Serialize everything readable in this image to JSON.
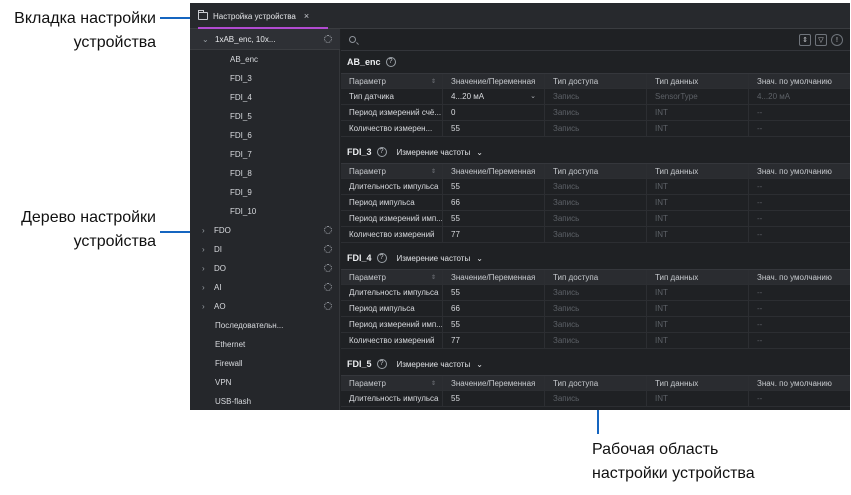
{
  "annotations": {
    "tab": [
      "Вкладка настройки",
      "устройства"
    ],
    "tree": [
      "Дерево настройки",
      "устройства"
    ],
    "workspace": [
      "Рабочая область",
      "настройки устройства"
    ]
  },
  "tab": {
    "title": "Настройка устройства",
    "icon": "folder-icon",
    "close": "×"
  },
  "sidebar": {
    "head": "1xAB_enc, 10x...",
    "children": [
      "AB_enc",
      "FDI_3",
      "FDI_4",
      "FDI_5",
      "FDI_6",
      "FDI_7",
      "FDI_8",
      "FDI_9",
      "FDI_10"
    ],
    "groups": [
      "FDO",
      "DI",
      "DO",
      "AI",
      "AO"
    ],
    "leaves": [
      "Последовательн...",
      "Ethernet",
      "Firewall",
      "VPN",
      "USB-flash"
    ]
  },
  "columns": [
    "Параметр",
    "Значение/Переменная",
    "Тип доступа",
    "Тип данных",
    "Знач. по умолчанию"
  ],
  "sections": [
    {
      "title": "AB_enc",
      "subtitle": "",
      "rows": [
        [
          "Тип датчика",
          "4...20 мА",
          "Запись",
          "SensorType",
          "4...20 мА"
        ],
        [
          "Период измерений счё...",
          "0",
          "Запись",
          "INT",
          "--"
        ],
        [
          "Количество измерен...",
          "55",
          "Запись",
          "INT",
          "--"
        ]
      ]
    },
    {
      "title": "FDI_3",
      "subtitle": "Измерение частоты",
      "rows": [
        [
          "Длительность импульса",
          "55",
          "Запись",
          "INT",
          "--"
        ],
        [
          "Период импульса",
          "66",
          "Запись",
          "INT",
          "--"
        ],
        [
          "Период измерений имп...",
          "55",
          "Запись",
          "INT",
          "--"
        ],
        [
          "Количество измерений",
          "77",
          "Запись",
          "INT",
          "--"
        ]
      ]
    },
    {
      "title": "FDI_4",
      "subtitle": "Измерение частоты",
      "rows": [
        [
          "Длительность импульса",
          "55",
          "Запись",
          "INT",
          "--"
        ],
        [
          "Период импульса",
          "66",
          "Запись",
          "INT",
          "--"
        ],
        [
          "Период измерений имп...",
          "55",
          "Запись",
          "INT",
          "--"
        ],
        [
          "Количество измерений",
          "77",
          "Запись",
          "INT",
          "--"
        ]
      ]
    },
    {
      "title": "FDI_5",
      "subtitle": "Измерение частоты",
      "rows": [
        [
          "Длительность импульса",
          "55",
          "Запись",
          "INT",
          "--"
        ]
      ]
    }
  ],
  "colors": {
    "accent": "#b14bd1",
    "leader": "#1565c0",
    "background": "#202225"
  }
}
